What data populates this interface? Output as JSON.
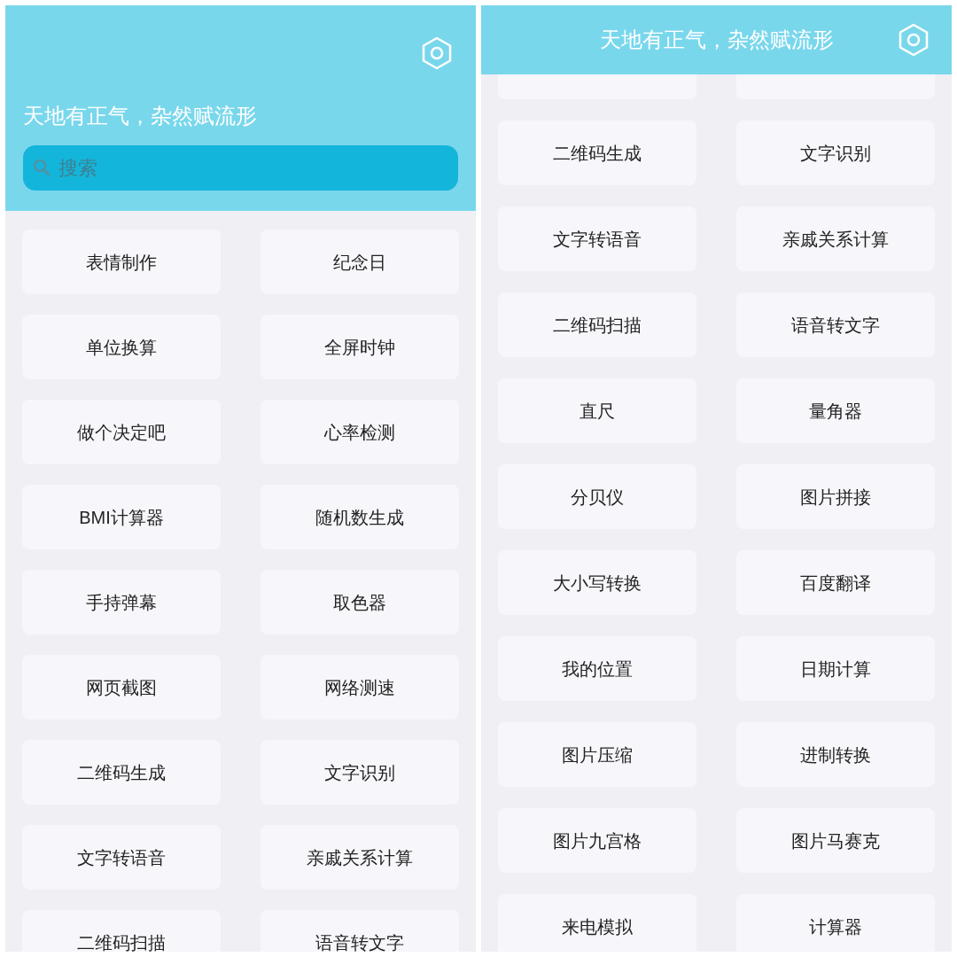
{
  "left_screen": {
    "title": "天地有正气，杂然赋流形",
    "search": {
      "placeholder": "搜索"
    },
    "items": [
      {
        "kind": "tile",
        "label": "表情制作"
      },
      {
        "kind": "tile",
        "label": "纪念日"
      },
      {
        "kind": "tile",
        "label": "单位换算"
      },
      {
        "kind": "tile",
        "label": "全屏时钟"
      },
      {
        "kind": "tile",
        "label": "做个决定吧"
      },
      {
        "kind": "tile",
        "label": "心率检测"
      },
      {
        "kind": "tile",
        "label": "BMI计算器"
      },
      {
        "kind": "tile",
        "label": "随机数生成"
      },
      {
        "kind": "tile",
        "label": "手持弹幕"
      },
      {
        "kind": "tile",
        "label": "取色器"
      },
      {
        "kind": "tile",
        "label": "网页截图"
      },
      {
        "kind": "tile",
        "label": "网络测速"
      },
      {
        "kind": "tile",
        "label": "二维码生成"
      },
      {
        "kind": "tile",
        "label": "文字识别"
      },
      {
        "kind": "tile",
        "label": "文字转语音"
      },
      {
        "kind": "tile",
        "label": "亲戚关系计算"
      },
      {
        "kind": "tile",
        "label": "二维码扫描"
      },
      {
        "kind": "tile",
        "label": "语音转文字"
      }
    ]
  },
  "right_screen": {
    "title": "天地有正气，杂然赋流形",
    "items": [
      {
        "kind": "cut"
      },
      {
        "kind": "cut"
      },
      {
        "kind": "tile",
        "label": "二维码生成"
      },
      {
        "kind": "tile",
        "label": "文字识别"
      },
      {
        "kind": "tile",
        "label": "文字转语音"
      },
      {
        "kind": "tile",
        "label": "亲戚关系计算"
      },
      {
        "kind": "tile",
        "label": "二维码扫描"
      },
      {
        "kind": "tile",
        "label": "语音转文字"
      },
      {
        "kind": "tile",
        "label": "直尺"
      },
      {
        "kind": "tile",
        "label": "量角器"
      },
      {
        "kind": "tile",
        "label": "分贝仪"
      },
      {
        "kind": "tile",
        "label": "图片拼接"
      },
      {
        "kind": "tile",
        "label": "大小写转换"
      },
      {
        "kind": "tile",
        "label": "百度翻译"
      },
      {
        "kind": "tile",
        "label": "我的位置"
      },
      {
        "kind": "tile",
        "label": "日期计算"
      },
      {
        "kind": "tile",
        "label": "图片压缩"
      },
      {
        "kind": "tile",
        "label": "进制转换"
      },
      {
        "kind": "tile",
        "label": "图片九宫格"
      },
      {
        "kind": "tile",
        "label": "图片马赛克"
      },
      {
        "kind": "tile",
        "label": "来电模拟"
      },
      {
        "kind": "tile",
        "label": "计算器"
      }
    ]
  }
}
